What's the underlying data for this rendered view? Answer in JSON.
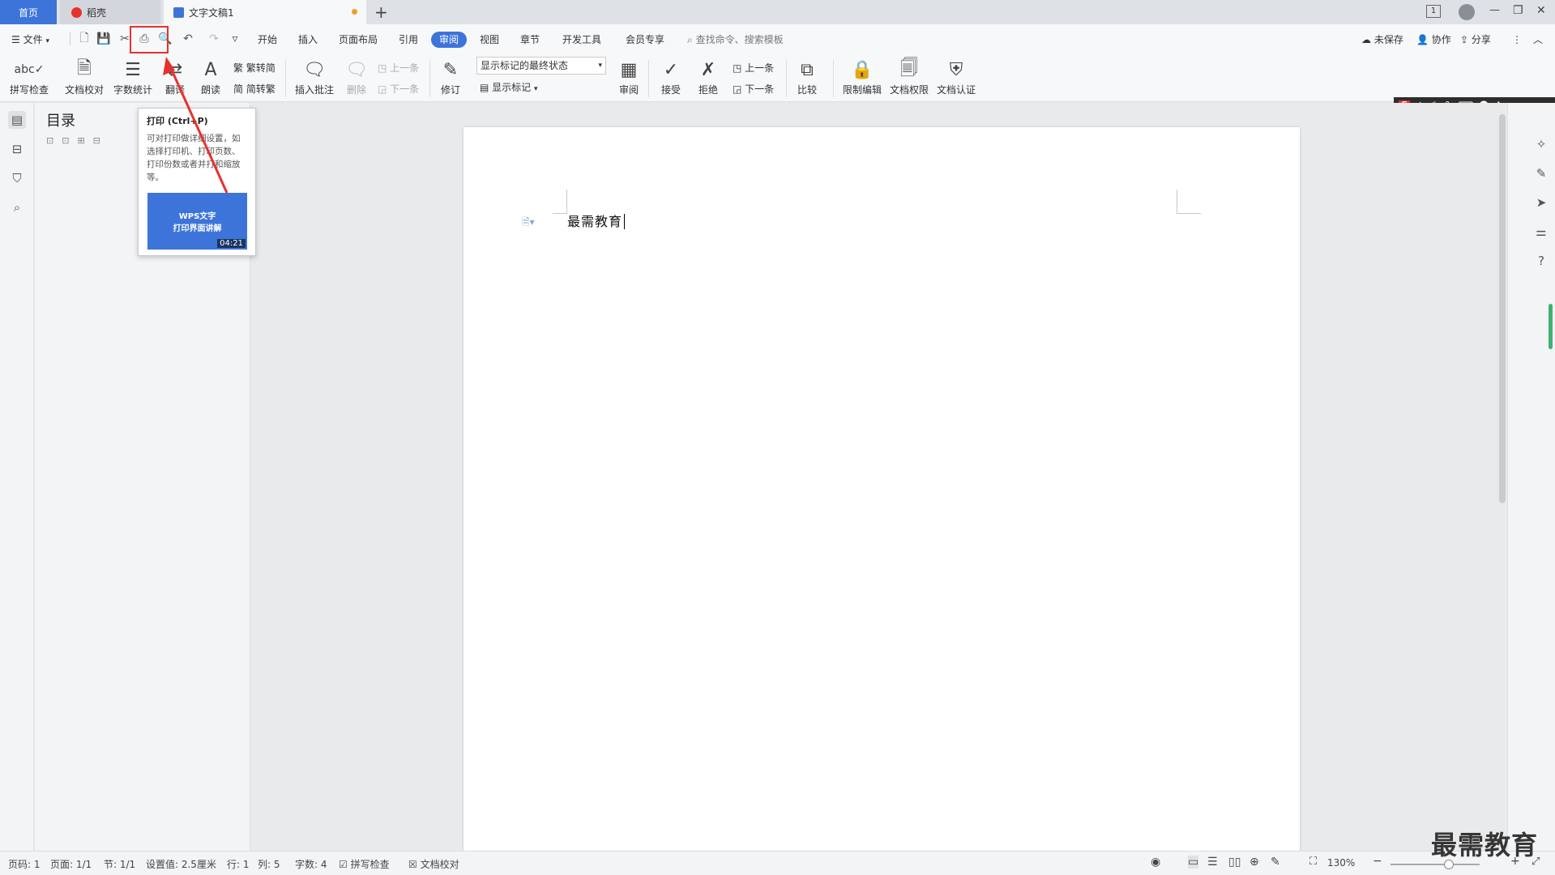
{
  "tabs": {
    "home": "首页",
    "daoke": "稻壳",
    "doc": "文字文稿1",
    "new": "+"
  },
  "window": {
    "min": "—",
    "restore": "❐",
    "close": "✕"
  },
  "menu": {
    "file": "文件",
    "items": [
      "开始",
      "插入",
      "页面布局",
      "引用",
      "审阅",
      "视图",
      "章节",
      "开发工具",
      "会员专享"
    ],
    "active": "审阅",
    "search_placeholder": "查找命令、搜索模板",
    "unsaved": "未保存",
    "collab": "协作",
    "share": "分享"
  },
  "ribbon": {
    "spell": "拼写检查",
    "proof": "文档校对",
    "wordcount": "字数统计",
    "translate": "翻译",
    "read": "朗读",
    "trad2simp": "繁转简",
    "simp2trad": "简转繁",
    "insert_comment": "插入批注",
    "delete": "删除",
    "prev": "上一条",
    "next": "下一条",
    "track": "修订",
    "markup_select": "显示标记的最终状态",
    "show_markup": "显示标记",
    "review": "审阅",
    "accept": "接受",
    "reject": "拒绝",
    "prev2": "上一条",
    "next2": "下一条",
    "compare": "比较",
    "restrict": "限制编辑",
    "rights": "文档权限",
    "cert": "文档认证"
  },
  "nav": {
    "title": "目录"
  },
  "tooltip": {
    "title": "打印 (Ctrl+P)",
    "desc": "可对打印做详细设置，如选择打印机、打印页数、打印份数或者并打和缩放等。",
    "video_line1": "WPS文字",
    "video_line2": "打印界面讲解",
    "video_time": "04:21"
  },
  "document": {
    "text": "最需教育"
  },
  "ime": {
    "lang": "中"
  },
  "status": {
    "page_code": "页码: 1",
    "page": "页面: 1/1",
    "section": "节: 1/1",
    "setting": "设置值: 2.5厘米",
    "row": "行: 1",
    "col": "列: 5",
    "words": "字数: 4",
    "spell": "拼写检查",
    "proof": "文档校对",
    "zoom": "130%"
  },
  "watermark": "最需教育",
  "colors": {
    "accent": "#3d74d9",
    "highlight": "#e5322d"
  }
}
